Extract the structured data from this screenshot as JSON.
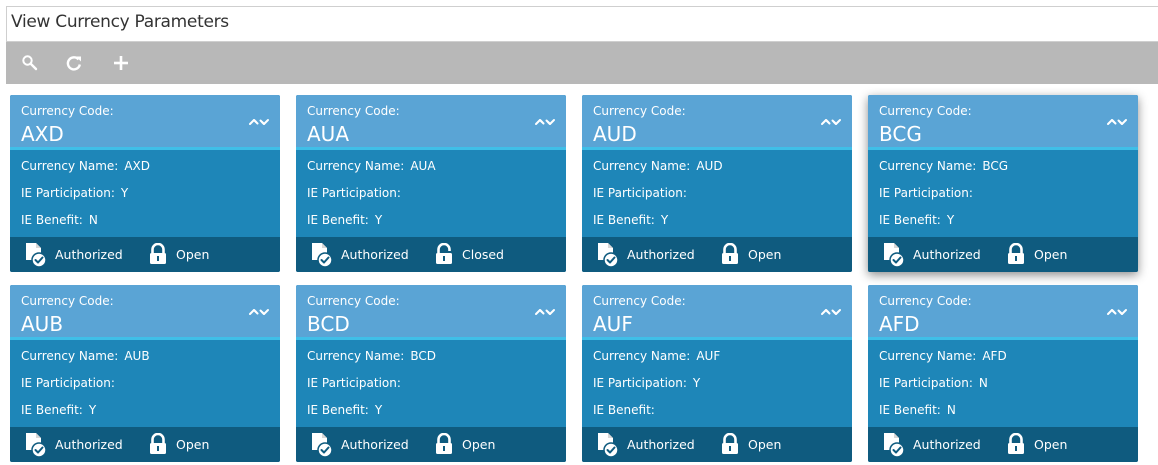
{
  "window": {
    "title": "View Currency Parameters"
  },
  "toolbar": {
    "tools": [
      {
        "icon": "search-icon"
      },
      {
        "icon": "refresh-icon"
      },
      {
        "icon": "add-icon"
      }
    ]
  },
  "labels": {
    "currency_code": "Currency Code:",
    "currency_name": "Currency Name:",
    "ie_participation": "IE Participation:",
    "ie_benefit": "IE Benefit:"
  },
  "colors": {
    "card_body": "#1e86b8",
    "card_header": "#5aa4d5",
    "header_accent": "#3fbfe8",
    "card_footer": "#0f5b7f",
    "toolbar": "#b8b8b8"
  },
  "cards": [
    {
      "code": "AXD",
      "name": "AXD",
      "ie_participation": "Y",
      "ie_benefit": "N",
      "auth_status": "Authorized",
      "record_status": "Open"
    },
    {
      "code": "AUA",
      "name": "AUA",
      "ie_participation": "",
      "ie_benefit": "Y",
      "auth_status": "Authorized",
      "record_status": "Closed"
    },
    {
      "code": "AUD",
      "name": "AUD",
      "ie_participation": "",
      "ie_benefit": "Y",
      "auth_status": "Authorized",
      "record_status": "Open"
    },
    {
      "code": "BCG",
      "name": "BCG",
      "ie_participation": "",
      "ie_benefit": "Y",
      "auth_status": "Authorized",
      "record_status": "Open"
    },
    {
      "code": "AUB",
      "name": "AUB",
      "ie_participation": "",
      "ie_benefit": "Y",
      "auth_status": "Authorized",
      "record_status": "Open"
    },
    {
      "code": "BCD",
      "name": "BCD",
      "ie_participation": "",
      "ie_benefit": "Y",
      "auth_status": "Authorized",
      "record_status": "Open"
    },
    {
      "code": "AUF",
      "name": "AUF",
      "ie_participation": "Y",
      "ie_benefit": "",
      "auth_status": "Authorized",
      "record_status": "Open"
    },
    {
      "code": "AFD",
      "name": "AFD",
      "ie_participation": "N",
      "ie_benefit": "N",
      "auth_status": "Authorized",
      "record_status": "Open"
    }
  ]
}
